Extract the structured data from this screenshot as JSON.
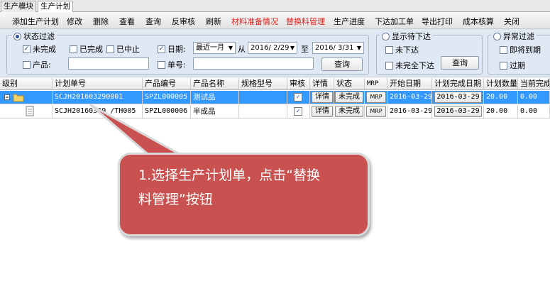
{
  "tabs": [
    "生产模块",
    "生产计划"
  ],
  "toolbar": [
    "添加生产计划",
    "修改",
    "删除",
    "查看",
    "查询",
    "反审核",
    "刷新",
    "材料准备情况",
    "替换料管理",
    "生产进度",
    "下达加工单",
    "导出打印",
    "成本核算",
    "关闭"
  ],
  "highlight_color": "#e0201c",
  "filter": {
    "status_group_title": "状态过滤",
    "status_options": [
      "未完成",
      "已完成",
      "已中止"
    ],
    "date_label": "日期:",
    "date_range": "最近一月",
    "from_label": "从",
    "date_from": "2016/ 2/29",
    "to_label": "至",
    "date_to": "2016/ 3/31",
    "product_label": "产品:",
    "order_label": "单号:",
    "query_button": "查询",
    "show_group_title": "显示待下达",
    "show_options": [
      "未下达",
      "未完全下达"
    ],
    "query_button2": "查询",
    "anomaly_group_title": "异常过滤",
    "anomaly_options": [
      "即将到期",
      "过期"
    ]
  },
  "grid": {
    "columns": [
      "级别",
      "计划单号",
      "产品编号",
      "产品名称",
      "规格型号",
      "审核",
      "详情",
      "状态",
      "MRP",
      "开始日期",
      "计划完成日期",
      "计划数量",
      "当前完成"
    ],
    "rows": [
      {
        "plan_no": "SCJH201603290001",
        "product_code": "SPZL000005",
        "product_name": "测试品",
        "spec": "",
        "detail": "详情",
        "status": "未完成",
        "mrp": "MRP",
        "start": "2016-03-29",
        "finish": "2016-03-29",
        "qty": "20.00",
        "done": "0.00"
      },
      {
        "plan_no": "SCJH20160329        /TH005",
        "product_code": "SPZL000006",
        "product_name": "半成品",
        "spec": "",
        "detail": "详情",
        "status": "未完成",
        "mrp": "MRP",
        "start": "2016-03-29",
        "finish": "2016-03-29",
        "qty": "20.00",
        "done": "0.00"
      }
    ]
  },
  "callout": {
    "line1": "1.选择生产计划单，点击“替换",
    "line2": "料管理”按钮"
  },
  "callout_color": "#c9514f"
}
